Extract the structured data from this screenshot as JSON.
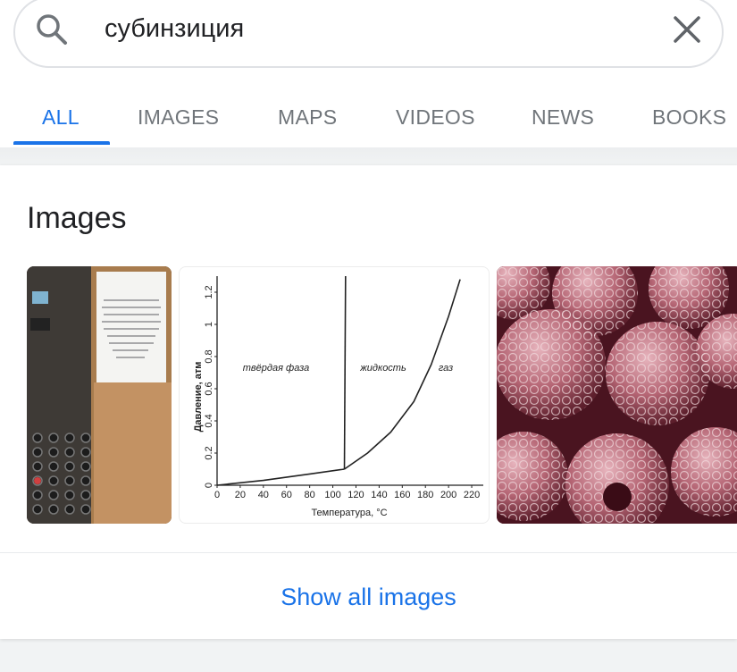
{
  "search": {
    "query": "субинзиция"
  },
  "tabs": [
    {
      "label": "ALL",
      "active": true
    },
    {
      "label": "IMAGES",
      "active": false
    },
    {
      "label": "MAPS",
      "active": false
    },
    {
      "label": "VIDEOS",
      "active": false
    },
    {
      "label": "NEWS",
      "active": false
    },
    {
      "label": "BOOKS",
      "active": false
    }
  ],
  "images_section": {
    "title": "Images",
    "show_all_label": "Show all images",
    "thumbnails": [
      {
        "icon": "elevator-photo"
      },
      {
        "icon": "phase-diagram-chart"
      },
      {
        "icon": "frozen-raspberries-photo"
      }
    ]
  },
  "chart_data": {
    "type": "line",
    "xlabel": "Температура, °С",
    "ylabel": "Давление, атм",
    "x_ticks": [
      0,
      20,
      40,
      60,
      80,
      100,
      120,
      140,
      160,
      180,
      200,
      220
    ],
    "y_ticks": [
      0,
      0.2,
      0.4,
      0.6,
      0.8,
      1.0,
      1.2
    ],
    "xlim": [
      0,
      230
    ],
    "ylim": [
      0,
      1.3
    ],
    "annotations": [
      "твёрдая фаза",
      "жидкость",
      "газ"
    ],
    "series": [
      {
        "x": [
          0,
          40,
          80,
          110
        ],
        "y": [
          0,
          0.03,
          0.07,
          0.1
        ]
      },
      {
        "x": [
          110,
          110.5,
          111
        ],
        "y": [
          0.1,
          0.7,
          1.3
        ]
      },
      {
        "x": [
          110,
          130,
          150,
          170,
          185,
          200,
          210
        ],
        "y": [
          0.1,
          0.2,
          0.33,
          0.52,
          0.75,
          1.05,
          1.28
        ]
      }
    ]
  },
  "colors": {
    "accent": "#1a73e8",
    "tab_inactive": "#70757a",
    "text": "#202124"
  }
}
